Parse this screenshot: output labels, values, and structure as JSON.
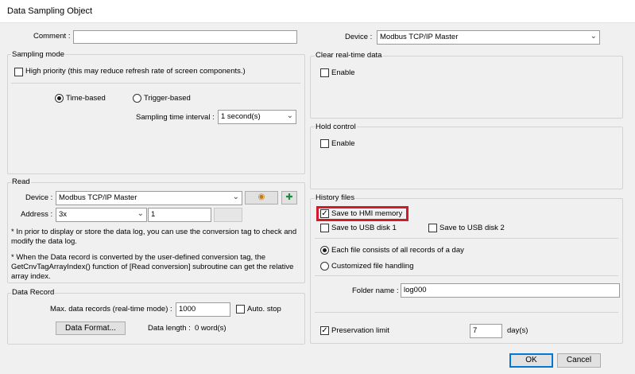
{
  "window": {
    "title": "Data Sampling Object"
  },
  "comment": {
    "label": "Comment :",
    "value": ""
  },
  "device": {
    "label": "Device :",
    "value": "Modbus TCP/IP Master"
  },
  "sampling_mode": {
    "title": "Sampling mode",
    "high_priority": {
      "label": "High priority (this may reduce refresh rate of screen components.)",
      "checked": false
    },
    "time_based": {
      "label": "Time-based",
      "selected": true
    },
    "trigger_based": {
      "label": "Trigger-based",
      "selected": false
    },
    "interval": {
      "label": "Sampling time interval :",
      "value": "1 second(s)"
    }
  },
  "clear_realtime": {
    "title": "Clear real-time data",
    "enable_label": "Enable",
    "checked": false
  },
  "hold_control": {
    "title": "Hold control",
    "enable_label": "Enable",
    "checked": false
  },
  "read": {
    "title": "Read",
    "device_label": "Device :",
    "device_value": "Modbus TCP/IP Master",
    "address_label": "Address :",
    "address_type": "3x",
    "address_value": "1",
    "note1": "* In prior to display or store the data log, you can use the conversion tag to check and modify the data log.",
    "note2": "* When the Data record is converted by the user-defined conversion tag, the GetCnvTagArrayIndex() function of [Read conversion] subroutine can get the relative array index."
  },
  "history": {
    "title": "History files",
    "save_hmi": {
      "label": "Save to HMI memory",
      "checked": true
    },
    "save_usb1": {
      "label": "Save to USB disk 1",
      "checked": false
    },
    "save_usb2": {
      "label": "Save to USB disk 2",
      "checked": false
    },
    "each_file": {
      "label": "Each file consists of all records of a day",
      "selected": true
    },
    "customized": {
      "label": "Customized file handling",
      "selected": false
    },
    "folder": {
      "label": "Folder name :",
      "value": "log000"
    },
    "preservation": {
      "label": "Preservation limit",
      "checked": true,
      "value": "7",
      "unit": "day(s)"
    }
  },
  "data_record": {
    "title": "Data Record",
    "max_label": "Max. data records (real-time mode) :",
    "max_value": "1000",
    "auto_stop": {
      "label": "Auto. stop",
      "checked": false
    },
    "format_button": "Data Format...",
    "length_label": "Data length :",
    "length_value": "0 word(s)"
  },
  "buttons": {
    "ok": "OK",
    "cancel": "Cancel"
  },
  "colors": {
    "highlight": "#d21a2a",
    "focus": "#0078d7"
  }
}
